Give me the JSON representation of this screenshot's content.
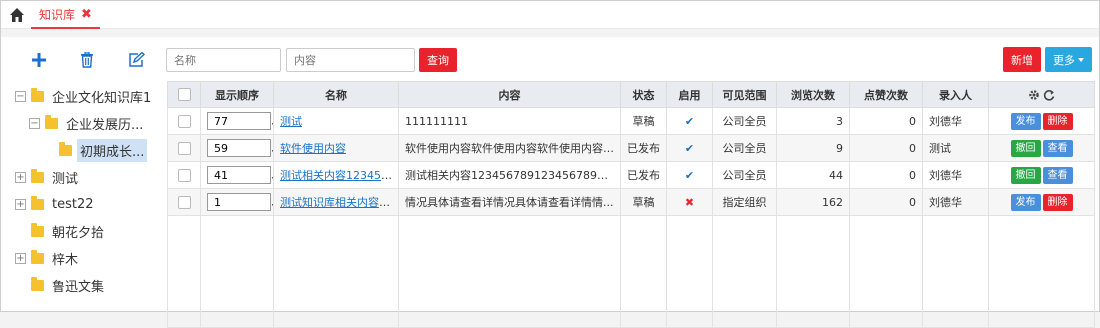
{
  "tabbar": {
    "home_icon": "home-icon",
    "tab_label": "知识库",
    "close_icon": "close-icon",
    "accent": "#e8383d"
  },
  "left_toolbar": {
    "add_icon": "plus-icon",
    "delete_icon": "trash-icon",
    "edit_icon": "edit-icon"
  },
  "tree": [
    {
      "label": "企业文化知识库1",
      "expander": "−",
      "level": 0
    },
    {
      "label": "企业发展历...",
      "expander": "−",
      "level": 1
    },
    {
      "label": "初期成长...",
      "expander": "",
      "level": 2,
      "selected": true
    },
    {
      "label": "测试",
      "expander": "+",
      "level": 0
    },
    {
      "label": "test22",
      "expander": "+",
      "level": 0
    },
    {
      "label": "朝花夕拾",
      "expander": "",
      "level": 0
    },
    {
      "label": "梓木",
      "expander": "+",
      "level": 0
    },
    {
      "label": "鲁迅文集",
      "expander": "",
      "level": 0
    }
  ],
  "search": {
    "name_placeholder": "名称",
    "content_placeholder": "内容",
    "query_label": "查询"
  },
  "actions": {
    "new_label": "新增",
    "more_label": "更多"
  },
  "table": {
    "headers": [
      "显示顺序",
      "名称",
      "内容",
      "状态",
      "启用",
      "可见范围",
      "浏览次数",
      "点赞次数",
      "录入人"
    ],
    "settings_icon": "gear-icon",
    "refresh_icon": "refresh-icon",
    "rows": [
      {
        "order": "77",
        "name": "测试",
        "content": "111111111",
        "status": "草稿",
        "enabled": true,
        "scope": "公司全员",
        "views": "3",
        "likes": "0",
        "author": "刘德华",
        "op1": "发布",
        "op2": "删除",
        "op1_color": "blue",
        "op2_color": "red"
      },
      {
        "order": "59",
        "name": "软件使用内容",
        "content": "软件使用内容软件使用内容软件使用内容软...",
        "status": "已发布",
        "enabled": true,
        "scope": "公司全员",
        "views": "9",
        "likes": "0",
        "author": "测试",
        "op1": "撤回",
        "op2": "查看",
        "op1_color": "green",
        "op2_color": "lblue"
      },
      {
        "order": "41",
        "name": "测试相关内容1234567...",
        "content": "测试相关内容1234567891234567891234S...",
        "status": "已发布",
        "enabled": true,
        "scope": "公司全员",
        "views": "44",
        "likes": "0",
        "author": "刘德华",
        "op1": "撤回",
        "op2": "查看",
        "op1_color": "green",
        "op2_color": "lblue"
      },
      {
        "order": "1",
        "name": "测试知识库相关内容展...",
        "content": "情况具体请查看详情况具体请查看详情情...",
        "status": "草稿",
        "enabled": false,
        "scope": "指定组织",
        "views": "162",
        "likes": "0",
        "author": "刘德华",
        "op1": "发布",
        "op2": "删除",
        "op1_color": "blue",
        "op2_color": "red"
      }
    ]
  }
}
